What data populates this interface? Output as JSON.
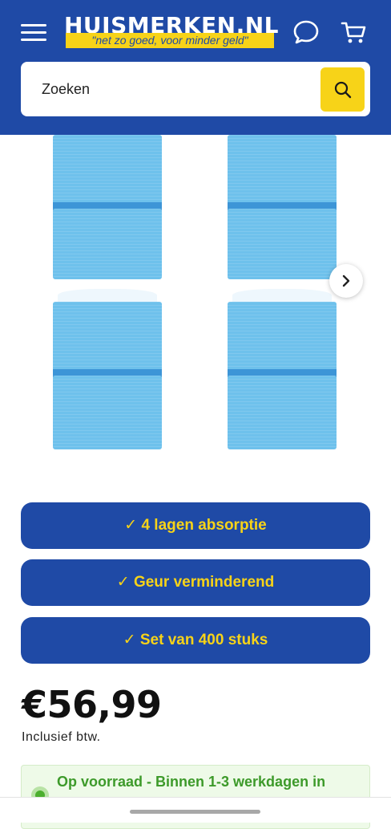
{
  "header": {
    "logo_text": "HUISMERKEN.NL",
    "logo_tagline": "\"net zo goed, voor minder geld\"",
    "search_placeholder": "Zoeken",
    "colors": {
      "brand_blue": "#1f4aa6",
      "brand_yellow": "#f7d318"
    },
    "icons": [
      "menu-icon",
      "chat-icon",
      "cart-icon",
      "search-icon"
    ]
  },
  "gallery": {
    "image_count_visible": 4,
    "next_icon": "chevron-right-icon"
  },
  "features": [
    {
      "label": "✓ 4 lagen absorptie"
    },
    {
      "label": "✓ Geur verminderend"
    },
    {
      "label": "✓ Set van 400 stuks"
    }
  ],
  "product": {
    "price": "€56,99",
    "tax_note": "Inclusief btw.",
    "stock_text": "Op voorraad - Binnen 1-3 werkdagen in"
  }
}
